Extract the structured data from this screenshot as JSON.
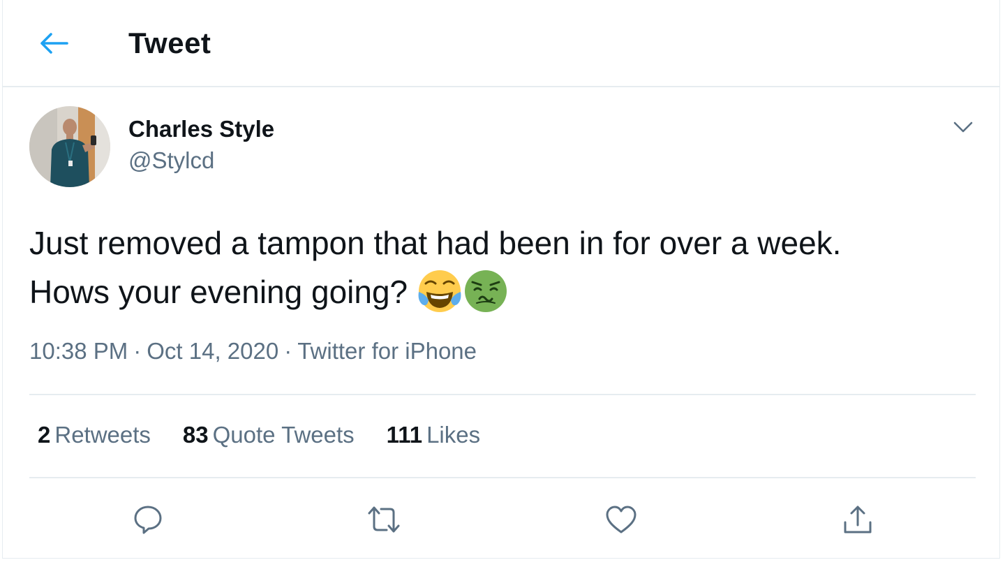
{
  "header": {
    "title": "Tweet",
    "back_icon": "arrow-left-icon"
  },
  "author": {
    "display_name": "Charles Style",
    "handle": "@Stylcd"
  },
  "tweet": {
    "text_line1": "Just removed a tampon that had been in for over a week.",
    "text_line2": "Hows your evening going?",
    "emojis": [
      "face-with-tears-of-joy",
      "nauseated-face"
    ],
    "time": "10:38 PM",
    "separator": "·",
    "date": "Oct 14, 2020",
    "source": "Twitter for iPhone"
  },
  "stats": {
    "retweets_count": "2",
    "retweets_label": "Retweets",
    "quotes_count": "83",
    "quotes_label": "Quote Tweets",
    "likes_count": "111",
    "likes_label": "Likes"
  },
  "actions": [
    "reply-icon",
    "retweet-icon",
    "like-icon",
    "share-icon"
  ],
  "colors": {
    "accent": "#1da1f2",
    "text_primary": "#0f1419",
    "text_secondary": "#5b7083",
    "divider": "#e6ecf0"
  }
}
